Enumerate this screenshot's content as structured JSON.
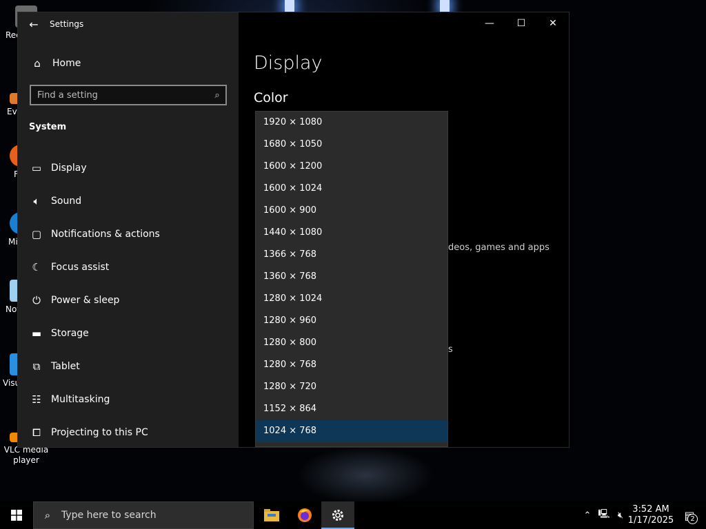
{
  "desktop": {
    "icons": [
      {
        "name": "recycle-bin-icon",
        "label": "Rec"
      },
      {
        "name": "everything-icon",
        "label": "Eve"
      },
      {
        "name": "firefox-desktop-icon",
        "label": "F"
      },
      {
        "name": "edge-desktop-icon",
        "label": "Mi"
      },
      {
        "name": "notepad-icon",
        "label": "Not"
      },
      {
        "name": "vscode-icon",
        "label": "Visu"
      },
      {
        "name": "vlc-icon",
        "label": "VLC media player"
      }
    ]
  },
  "window": {
    "title": "Settings",
    "controls": {
      "minimize": "—",
      "maximize": "☐",
      "close": "✕"
    }
  },
  "nav": {
    "home": "Home",
    "search_placeholder": "Find a setting",
    "section": "System",
    "items": [
      {
        "label": "Display",
        "icon": "monitor-icon"
      },
      {
        "label": "Sound",
        "icon": "speaker-icon"
      },
      {
        "label": "Notifications & actions",
        "icon": "notification-icon"
      },
      {
        "label": "Focus assist",
        "icon": "moon-icon"
      },
      {
        "label": "Power & sleep",
        "icon": "power-icon"
      },
      {
        "label": "Storage",
        "icon": "storage-icon"
      },
      {
        "label": "Tablet",
        "icon": "tablet-icon"
      },
      {
        "label": "Multitasking",
        "icon": "multitasking-icon"
      },
      {
        "label": "Projecting to this PC",
        "icon": "projecting-icon"
      }
    ]
  },
  "content": {
    "title": "Display",
    "section": "Color",
    "partial_text_1": "deos, games and apps",
    "partial_text_2": "s"
  },
  "dropdown": {
    "options": [
      "1920 × 1080",
      "1680 × 1050",
      "1600 × 1200",
      "1600 × 1024",
      "1600 × 900",
      "1440 × 1080",
      "1366 × 768",
      "1360 × 768",
      "1280 × 1024",
      "1280 × 960",
      "1280 × 800",
      "1280 × 768",
      "1280 × 720",
      "1152 × 864",
      "1024 × 768"
    ],
    "selected": "1024 × 768"
  },
  "taskbar": {
    "search_placeholder": "Type here to search",
    "time": "3:52 AM",
    "date": "1/17/2025",
    "notification_count": "2"
  },
  "colors": {
    "nav_bg": "#1f1f1f",
    "content_bg": "#000000",
    "dropdown_bg": "#2b2b2b",
    "selected_bg": "#0e3656",
    "accent": "#7aa7e0"
  }
}
